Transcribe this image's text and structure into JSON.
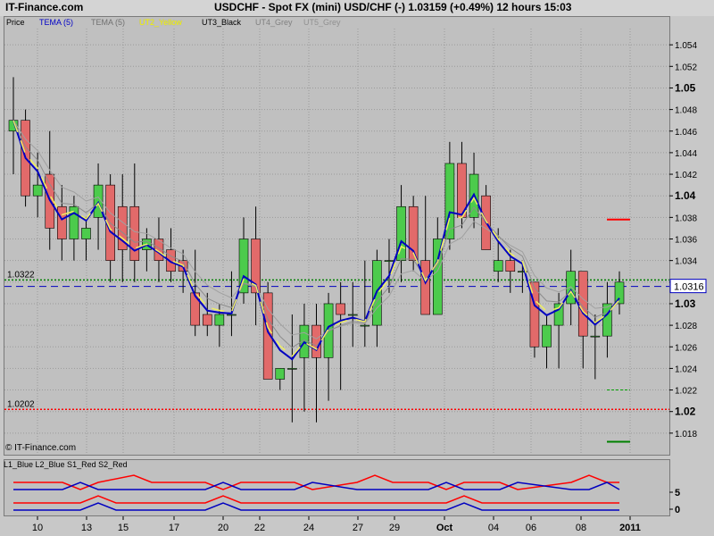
{
  "header": {
    "site": "IT-Finance.com",
    "title": "USDCHF - Spot FX (mini) USD/CHF (-)    1.03159 (+0.49%)    12 hours  15:03"
  },
  "legend": [
    {
      "label": "Price",
      "color": "#000000"
    },
    {
      "label": "TEMA (5)",
      "color": "#0000c8"
    },
    {
      "label": "TEMA (5)",
      "color": "#707070"
    },
    {
      "label": "UT2_Yellow",
      "color": "#ffff00"
    },
    {
      "label": "UT3_Black",
      "color": "#000000"
    },
    {
      "label": "UT4_Grey",
      "color": "#808080"
    },
    {
      "label": "UT5_Grey",
      "color": "#909090"
    }
  ],
  "watermark": "© IT-Finance.com",
  "osc_legend": "L1_Blue L2_Blue S1_Red S2_Red",
  "colors": {
    "up": "#4ccb4c",
    "down": "#e26a6a",
    "tema_blue": "#0000c0",
    "yellow": "#ffff40"
  },
  "chart_data": {
    "type": "candlestick",
    "price_axis": {
      "min": 1.016,
      "max": 1.056,
      "ticks": [
        "1.054",
        "1.052",
        "1.05",
        "1.048",
        "1.046",
        "1.044",
        "1.042",
        "1.04",
        "1.038",
        "1.036",
        "1.034",
        "1.032",
        "1.03",
        "1.028",
        "1.026",
        "1.024",
        "1.022",
        "1.02",
        "1.018"
      ],
      "bold_ticks": [
        "1.05",
        "1.04",
        "1.03",
        "1.02"
      ]
    },
    "x_labels": [
      "10",
      "13",
      "15",
      "17",
      "20",
      "22",
      "24",
      "27",
      "29",
      "Oct",
      "04",
      "06",
      "08",
      "2011"
    ],
    "current_price_label": "1.0316",
    "current_price": 1.0316,
    "level_lines": [
      {
        "label": "1.0322",
        "value": 1.0322,
        "color": "#008000"
      },
      {
        "label": "1.0202",
        "value": 1.0202,
        "color": "#ff0000"
      }
    ],
    "candles": [
      {
        "o": 1.046,
        "h": 1.051,
        "l": 1.042,
        "c": 1.047
      },
      {
        "o": 1.047,
        "h": 1.048,
        "l": 1.039,
        "c": 1.04
      },
      {
        "o": 1.04,
        "h": 1.044,
        "l": 1.038,
        "c": 1.041
      },
      {
        "o": 1.042,
        "h": 1.046,
        "l": 1.035,
        "c": 1.037
      },
      {
        "o": 1.039,
        "h": 1.041,
        "l": 1.034,
        "c": 1.036
      },
      {
        "o": 1.036,
        "h": 1.04,
        "l": 1.034,
        "c": 1.039
      },
      {
        "o": 1.036,
        "h": 1.038,
        "l": 1.034,
        "c": 1.037
      },
      {
        "o": 1.038,
        "h": 1.043,
        "l": 1.035,
        "c": 1.041
      },
      {
        "o": 1.041,
        "h": 1.042,
        "l": 1.032,
        "c": 1.034
      },
      {
        "o": 1.039,
        "h": 1.042,
        "l": 1.032,
        "c": 1.035
      },
      {
        "o": 1.039,
        "h": 1.043,
        "l": 1.032,
        "c": 1.034
      },
      {
        "o": 1.035,
        "h": 1.037,
        "l": 1.033,
        "c": 1.036
      },
      {
        "o": 1.036,
        "h": 1.038,
        "l": 1.032,
        "c": 1.034
      },
      {
        "o": 1.035,
        "h": 1.037,
        "l": 1.032,
        "c": 1.033
      },
      {
        "o": 1.034,
        "h": 1.035,
        "l": 1.031,
        "c": 1.033
      },
      {
        "o": 1.031,
        "h": 1.035,
        "l": 1.027,
        "c": 1.028
      },
      {
        "o": 1.029,
        "h": 1.031,
        "l": 1.027,
        "c": 1.028
      },
      {
        "o": 1.028,
        "h": 1.03,
        "l": 1.026,
        "c": 1.029
      },
      {
        "o": 1.029,
        "h": 1.033,
        "l": 1.027,
        "c": 1.029
      },
      {
        "o": 1.031,
        "h": 1.038,
        "l": 1.03,
        "c": 1.036
      },
      {
        "o": 1.036,
        "h": 1.039,
        "l": 1.028,
        "c": 1.031
      },
      {
        "o": 1.031,
        "h": 1.032,
        "l": 1.023,
        "c": 1.023
      },
      {
        "o": 1.023,
        "h": 1.024,
        "l": 1.022,
        "c": 1.024
      },
      {
        "o": 1.024,
        "h": 1.029,
        "l": 1.019,
        "c": 1.024
      },
      {
        "o": 1.025,
        "h": 1.03,
        "l": 1.02,
        "c": 1.028
      },
      {
        "o": 1.028,
        "h": 1.03,
        "l": 1.019,
        "c": 1.025
      },
      {
        "o": 1.025,
        "h": 1.031,
        "l": 1.021,
        "c": 1.03
      },
      {
        "o": 1.03,
        "h": 1.032,
        "l": 1.022,
        "c": 1.029
      },
      {
        "o": 1.029,
        "h": 1.032,
        "l": 1.026,
        "c": 1.029
      },
      {
        "o": 1.028,
        "h": 1.034,
        "l": 1.026,
        "c": 1.028
      },
      {
        "o": 1.028,
        "h": 1.035,
        "l": 1.026,
        "c": 1.034
      },
      {
        "o": 1.034,
        "h": 1.036,
        "l": 1.031,
        "c": 1.034
      },
      {
        "o": 1.034,
        "h": 1.041,
        "l": 1.032,
        "c": 1.039
      },
      {
        "o": 1.039,
        "h": 1.04,
        "l": 1.033,
        "c": 1.034
      },
      {
        "o": 1.034,
        "h": 1.04,
        "l": 1.029,
        "c": 1.029
      },
      {
        "o": 1.029,
        "h": 1.038,
        "l": 1.029,
        "c": 1.036
      },
      {
        "o": 1.036,
        "h": 1.045,
        "l": 1.035,
        "c": 1.043
      },
      {
        "o": 1.043,
        "h": 1.045,
        "l": 1.037,
        "c": 1.038
      },
      {
        "o": 1.038,
        "h": 1.044,
        "l": 1.037,
        "c": 1.042
      },
      {
        "o": 1.04,
        "h": 1.041,
        "l": 1.035,
        "c": 1.035
      },
      {
        "o": 1.033,
        "h": 1.037,
        "l": 1.032,
        "c": 1.034
      },
      {
        "o": 1.034,
        "h": 1.035,
        "l": 1.031,
        "c": 1.033
      },
      {
        "o": 1.033,
        "h": 1.034,
        "l": 1.031,
        "c": 1.033
      },
      {
        "o": 1.032,
        "h": 1.032,
        "l": 1.025,
        "c": 1.026
      },
      {
        "o": 1.026,
        "h": 1.029,
        "l": 1.024,
        "c": 1.028
      },
      {
        "o": 1.028,
        "h": 1.031,
        "l": 1.024,
        "c": 1.03
      },
      {
        "o": 1.03,
        "h": 1.035,
        "l": 1.028,
        "c": 1.033
      },
      {
        "o": 1.033,
        "h": 1.033,
        "l": 1.024,
        "c": 1.027
      },
      {
        "o": 1.027,
        "h": 1.029,
        "l": 1.023,
        "c": 1.027
      },
      {
        "o": 1.027,
        "h": 1.032,
        "l": 1.025,
        "c": 1.03
      },
      {
        "o": 1.03,
        "h": 1.033,
        "l": 1.029,
        "c": 1.032
      }
    ],
    "osc_ticks": [
      "5",
      "0"
    ]
  }
}
